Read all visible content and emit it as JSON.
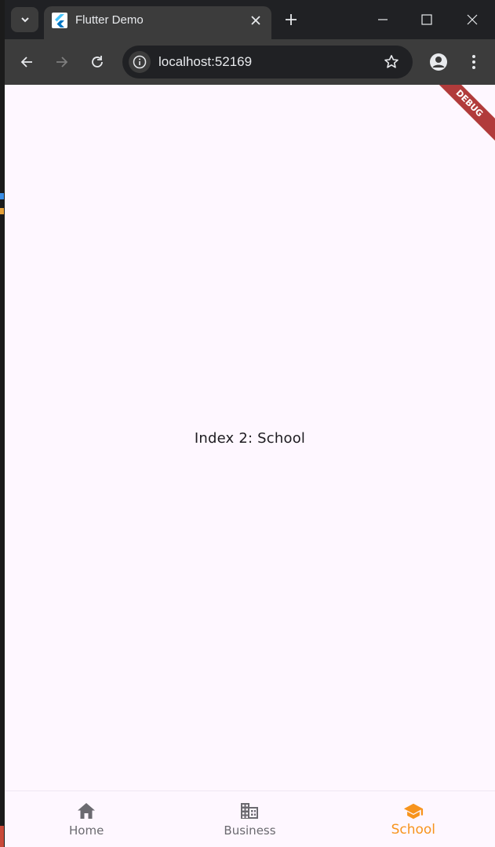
{
  "browser": {
    "tab_title": "Flutter Demo",
    "url": "localhost:52169"
  },
  "page": {
    "center_text": "Index 2: School",
    "debug_banner": "DEBUG",
    "background": "#fef7ff"
  },
  "bottom_nav": {
    "items": [
      {
        "label": "Home",
        "icon": "home-icon",
        "active": false
      },
      {
        "label": "Business",
        "icon": "business-icon",
        "active": false
      },
      {
        "label": "School",
        "icon": "school-icon",
        "active": true
      }
    ],
    "active_color": "#f7941d",
    "inactive_color": "#6b6a70"
  }
}
